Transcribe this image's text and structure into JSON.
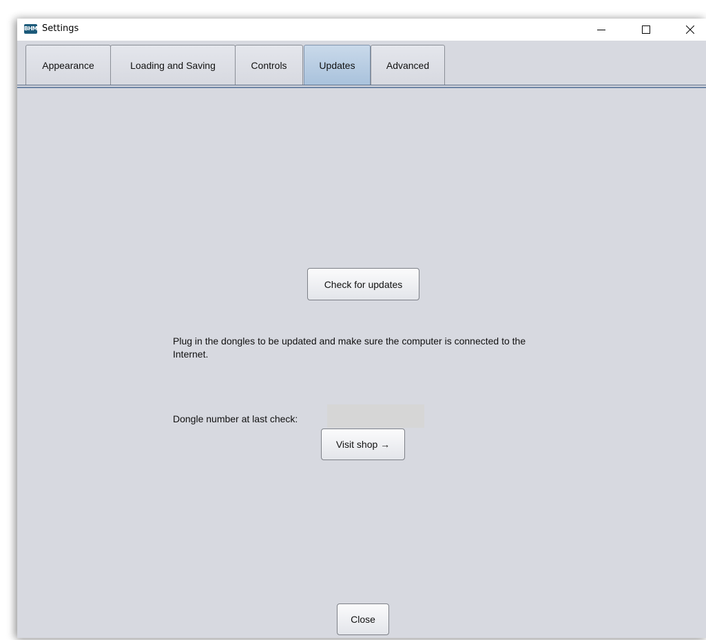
{
  "window": {
    "title": "Settings",
    "icon": "app-logo-icon",
    "icon_text": "BHM",
    "controls": [
      "minimize-icon",
      "maximize-icon",
      "close-icon"
    ]
  },
  "tabs": [
    {
      "label": "Appearance",
      "active": false
    },
    {
      "label": "Loading and Saving",
      "active": false
    },
    {
      "label": "Controls",
      "active": false
    },
    {
      "label": "Updates",
      "active": true
    },
    {
      "label": "Advanced",
      "active": false
    }
  ],
  "updates": {
    "check_button": "Check for updates",
    "info_text": "Plug in the dongles to be updated and make sure the computer is connected to the Internet.",
    "dongle_label": "Dongle number at last check:",
    "dongle_value": "",
    "shop_button": "Visit shop →"
  },
  "footer": {
    "close_button": "Close"
  },
  "colors": {
    "background": "#d7d9e0",
    "active_tab": "#b4cbe3",
    "tab_underline": "#6e86a6"
  }
}
